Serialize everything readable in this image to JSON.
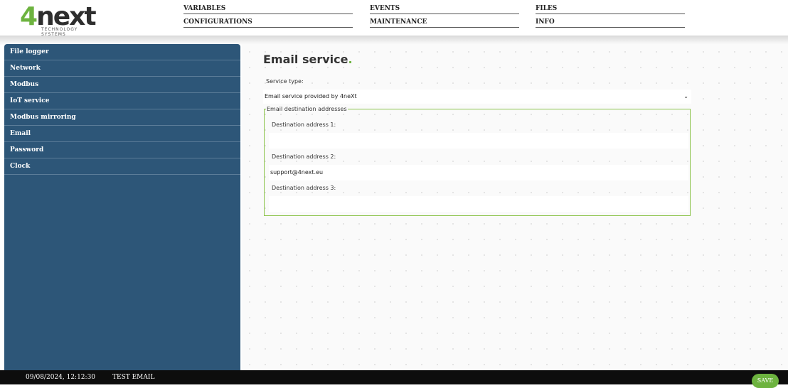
{
  "header": {
    "logo_text": "4next",
    "logo_subtext": "TECHNOLOGY SYSTEMS",
    "nav": [
      {
        "label": "VARIABLES"
      },
      {
        "label": "EVENTS"
      },
      {
        "label": "FILES"
      },
      {
        "label": "CONFIGURATIONS"
      },
      {
        "label": "MAINTENANCE"
      },
      {
        "label": "INFO"
      }
    ]
  },
  "sidebar": {
    "items": [
      {
        "label": "File logger"
      },
      {
        "label": "Network"
      },
      {
        "label": "Modbus"
      },
      {
        "label": "IoT service"
      },
      {
        "label": "Modbus mirroring"
      },
      {
        "label": "Email"
      },
      {
        "label": "Password"
      },
      {
        "label": "Clock"
      }
    ]
  },
  "main": {
    "title": "Email service",
    "title_suffix": ".",
    "service_type_label": "Service type:",
    "service_type_value": "Email service provided by 4neXt",
    "destinations_legend": "Email destination addresses",
    "destinations": [
      {
        "label": "Destination address 1:",
        "value": ""
      },
      {
        "label": "Destination address 2:",
        "value": "support@4next.eu"
      },
      {
        "label": "Destination address 3:",
        "value": ""
      }
    ]
  },
  "footer": {
    "datetime": "09/08/2024, 12:12:30",
    "test_email_label": "TEST EMAIL",
    "save_label": "SAVE"
  },
  "colors": {
    "sidebar_bg": "#2d5678",
    "accent_green": "#6db33f",
    "footer_bg": "#0d0d0d"
  },
  "icons": {
    "select_chevron": "chevron-down-icon"
  }
}
